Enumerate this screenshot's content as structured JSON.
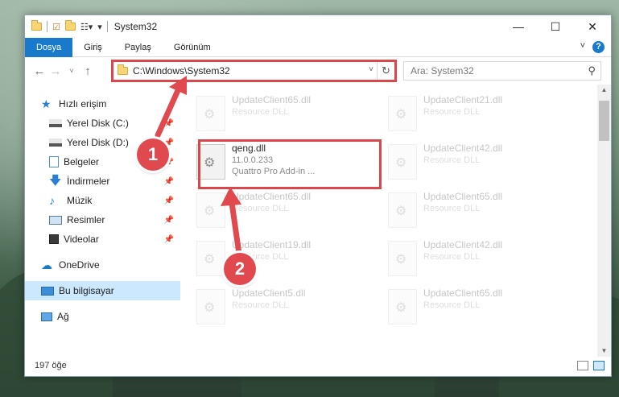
{
  "window": {
    "title": "System32",
    "controls": [
      "—",
      "☐",
      "✕"
    ]
  },
  "ribbon": {
    "tabs": [
      "Dosya",
      "Giriş",
      "Paylaş",
      "Görünüm"
    ],
    "active_tab": "Dosya",
    "help": "?"
  },
  "nav": {
    "address": "C:\\Windows\\System32",
    "search_placeholder": "Ara: System32"
  },
  "sidebar": {
    "quick_access": "Hızlı erişim",
    "items": [
      {
        "label": "Yerel Disk (C:)",
        "icon": "drive-icon",
        "pinned": true
      },
      {
        "label": "Yerel Disk (D:)",
        "icon": "drive-icon",
        "pinned": true
      },
      {
        "label": "Belgeler",
        "icon": "documents-icon",
        "pinned": true
      },
      {
        "label": "İndirmeler",
        "icon": "downloads-icon",
        "pinned": true
      },
      {
        "label": "Müzik",
        "icon": "music-icon",
        "pinned": true
      },
      {
        "label": "Resimler",
        "icon": "pictures-icon",
        "pinned": true
      },
      {
        "label": "Videolar",
        "icon": "videos-icon",
        "pinned": true
      }
    ],
    "onedrive": "OneDrive",
    "this_pc": "Bu bilgisayar",
    "network": "Ağ"
  },
  "files": {
    "left": [
      {
        "name": "UpdateClient65.dll",
        "sub": "Resource DLL"
      },
      {
        "name": "qeng.dll",
        "version": "11.0.0.233",
        "sub": "Quattro Pro Add-in ..."
      },
      {
        "name": "UpdateClient65.dll",
        "sub": "Resource DLL"
      },
      {
        "name": "UpdateClient19.dll",
        "sub": "Resource DLL"
      },
      {
        "name": "UpdateClient5.dll",
        "sub": "Resource DLL"
      }
    ],
    "right": [
      {
        "name": "UpdateClient21.dll",
        "sub": "Resource DLL"
      },
      {
        "name": "UpdateClient42.dll",
        "sub": "Resource DLL"
      },
      {
        "name": "UpdateClient65.dll",
        "sub": "Resource DLL"
      },
      {
        "name": "UpdateClient42.dll",
        "sub": "Resource DLL"
      },
      {
        "name": "UpdateClient65.dll",
        "sub": "Resource DLL"
      }
    ]
  },
  "status": {
    "count": "197 öğe"
  },
  "annotations": {
    "step1": "1",
    "step2": "2",
    "color": "#e04a4f"
  }
}
